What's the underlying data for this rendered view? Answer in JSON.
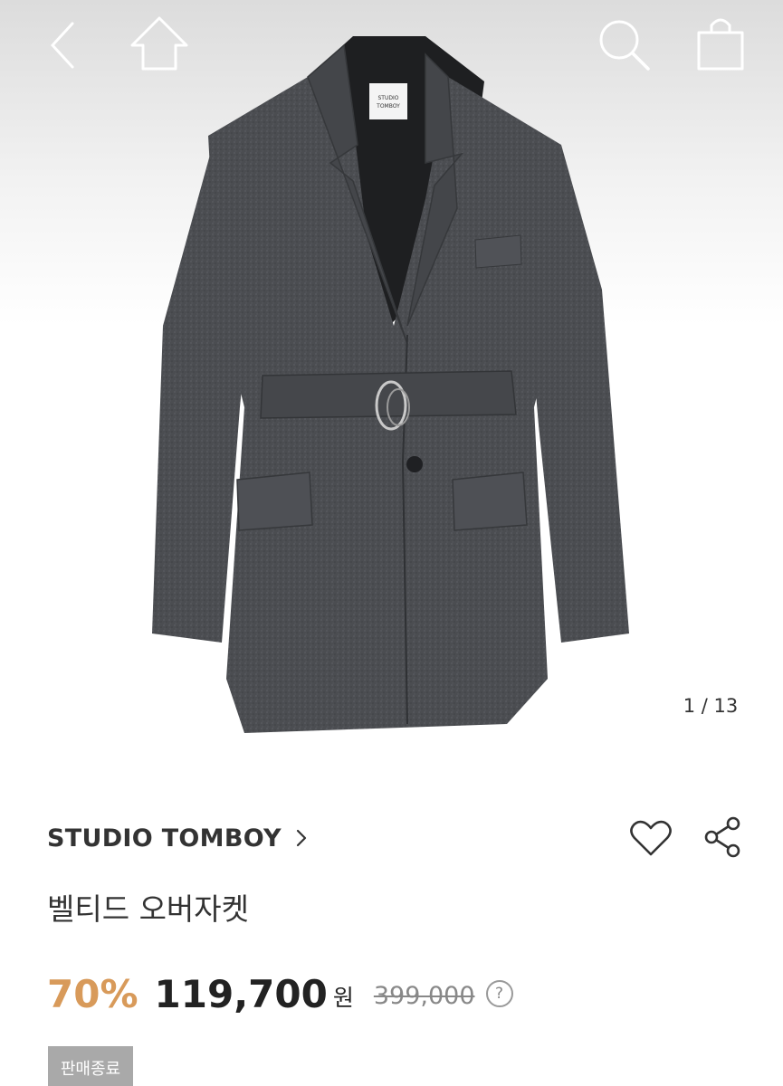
{
  "header": {
    "back_icon": "chevron-left-icon",
    "home_icon": "home-icon",
    "search_icon": "search-icon",
    "bag_icon": "shopping-bag-icon"
  },
  "gallery": {
    "current": "1",
    "separator": "/",
    "total": "13",
    "label": "1 / 13",
    "image_alt": "charcoal wool belted jacket"
  },
  "product": {
    "brand": "STUDIO TOMBOY",
    "title": "벨티드 오버자켓",
    "discount": "70%",
    "sale_price": "119,700",
    "currency": "원",
    "original_price": "399,000",
    "help_label": "?",
    "status": "판매종료"
  },
  "actions": {
    "wishlist_icon": "heart-icon",
    "share_icon": "share-icon"
  },
  "colors": {
    "discount": "#d89a5a",
    "badge_bg": "#a9a9a9",
    "coat": "#4a4c4f"
  }
}
